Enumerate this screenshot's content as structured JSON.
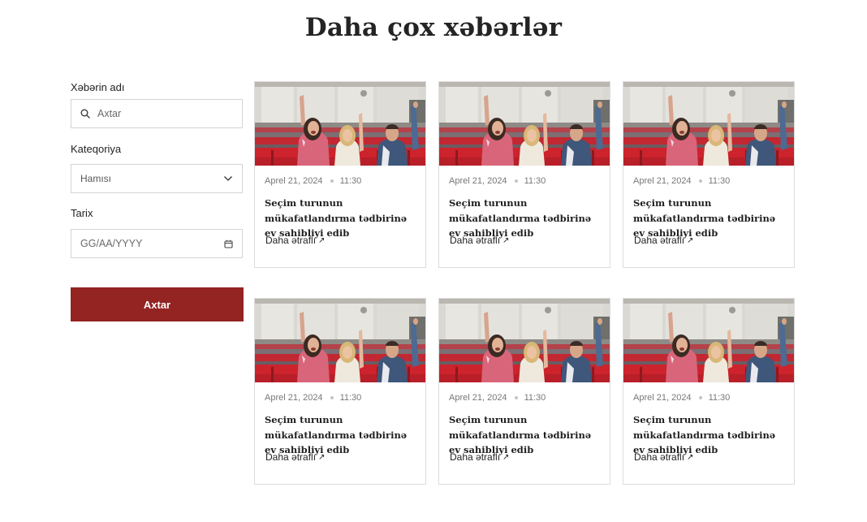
{
  "page_title": "Daha çox xəbərlər",
  "filters": {
    "name_label": "Xəbərin adı",
    "search_placeholder": "Axtar",
    "category_label": "Kateqoriya",
    "category_selected": "Hamısı",
    "date_label": "Tarix",
    "date_placeholder": "GG/AA/YYYY",
    "submit_label": "Axtar"
  },
  "icons": {
    "search": "search-icon",
    "dropdown": "chevron-down-icon",
    "calendar": "calendar-icon",
    "link_arrow": "arrow-up-right-icon"
  },
  "colors": {
    "accent": "#932422",
    "border": "#d4d4d4",
    "seat_red": "#c8232c"
  },
  "news": [
    {
      "date": "Aprel 21, 2024",
      "time": "11:30",
      "title": "Seçim turunun mükafatlandırma tədbirinə ev sahibliyi edib",
      "link": "Daha ətraflı"
    },
    {
      "date": "Aprel 21, 2024",
      "time": "11:30",
      "title": "Seçim turunun mükafatlandırma tədbirinə ev sahibliyi edib",
      "link": "Daha ətraflı"
    },
    {
      "date": "Aprel 21, 2024",
      "time": "11:30",
      "title": "Seçim turunun mükafatlandırma tədbirinə ev sahibliyi edib",
      "link": "Daha ətraflı"
    },
    {
      "date": "Aprel 21, 2024",
      "time": "11:30",
      "title": "Seçim turunun mükafatlandırma tədbirinə ev sahibliyi edib",
      "link": "Daha ətraflı"
    },
    {
      "date": "Aprel 21, 2024",
      "time": "11:30",
      "title": "Seçim turunun mükafatlandırma tədbirinə ev sahibliyi edib",
      "link": "Daha ətraflı"
    },
    {
      "date": "Aprel 21, 2024",
      "time": "11:30",
      "title": "Seçim turunun mükafatlandırma tədbirinə ev sahibliyi edib",
      "link": "Daha ətraflı"
    }
  ]
}
